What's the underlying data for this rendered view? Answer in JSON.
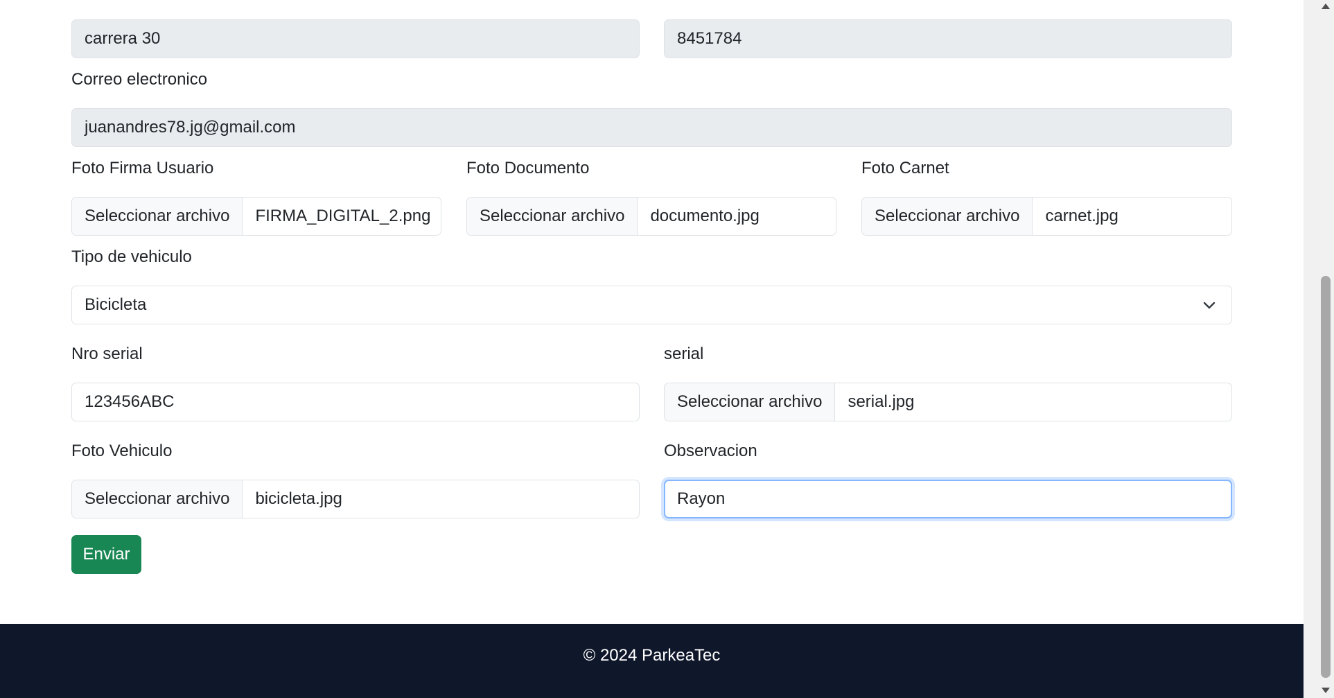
{
  "form": {
    "address_value": "carrera 30",
    "phone_value": "8451784",
    "email_label": "Correo electronico",
    "email_value": "juanandres78.jg@gmail.com",
    "signature_photo_label": "Foto Firma Usuario",
    "signature_file_button": "Seleccionar archivo",
    "signature_file_name": "FIRMA_DIGITAL_2.png",
    "document_photo_label": "Foto Documento",
    "document_file_button": "Seleccionar archivo",
    "document_file_name": "documento.jpg",
    "carnet_photo_label": "Foto Carnet",
    "carnet_file_button": "Seleccionar archivo",
    "carnet_file_name": "carnet.jpg",
    "vehicle_type_label": "Tipo de vehiculo",
    "vehicle_type_value": "Bicicleta",
    "serial_number_label": "Nro serial",
    "serial_number_value": "123456ABC",
    "serial_photo_label": "serial",
    "serial_file_button": "Seleccionar archivo",
    "serial_file_name": "serial.jpg",
    "vehicle_photo_label": "Foto Vehiculo",
    "vehicle_file_button": "Seleccionar archivo",
    "vehicle_file_name": "bicicleta.jpg",
    "observation_label": "Observacion",
    "observation_value": "Rayon",
    "submit_label": "Enviar"
  },
  "footer": {
    "copyright": "© 2024 ParkeaTec"
  },
  "colors": {
    "submit": "#198754",
    "footer_bg": "#0f172a",
    "disabled_bg": "#e9ecef",
    "focus_border": "#86b7fe"
  },
  "icons": {
    "select_chevron": "chevron-down-icon",
    "scroll_up": "scroll-up-arrow-icon",
    "scroll_down": "scroll-down-arrow-icon"
  }
}
